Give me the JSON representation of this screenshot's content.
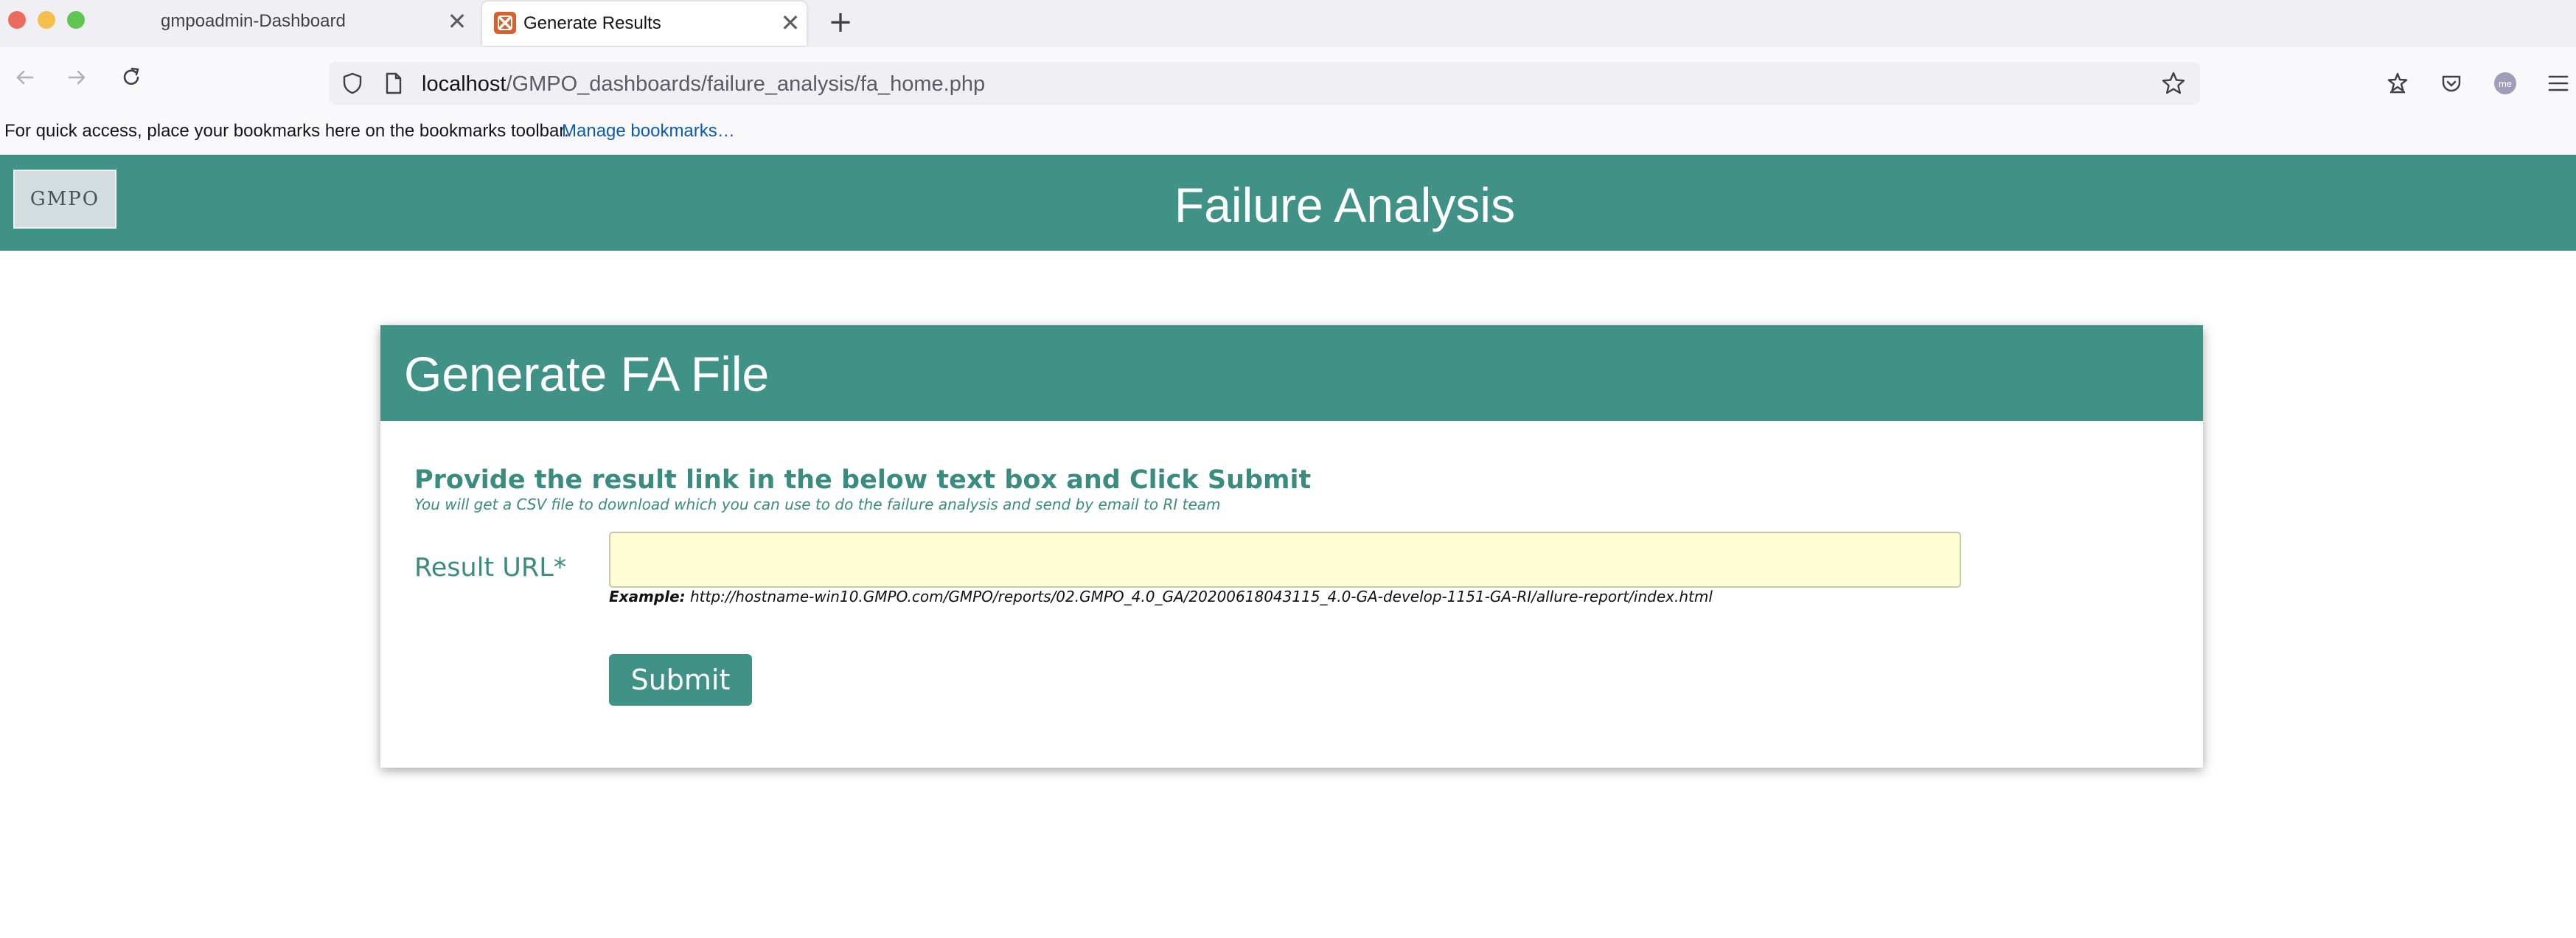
{
  "browser": {
    "tabs": [
      {
        "title": "gmpoadmin-Dashboard",
        "active": false
      },
      {
        "title": "Generate Results",
        "active": true
      }
    ],
    "close_glyph": "✕",
    "new_tab_glyph": "+",
    "url": {
      "host": "localhost",
      "path": "/GMPO_dashboards/failure_analysis/fa_home.php"
    },
    "avatar_initials": "me",
    "bookmarks_bar": {
      "text": "For quick access, place your bookmarks here on the bookmarks toolbar.",
      "link": "Manage bookmarks…"
    }
  },
  "header": {
    "logo_text": "GMPO",
    "title": "Failure Analysis"
  },
  "card": {
    "title": "Generate FA File",
    "instruction_title": "Provide the result link in the below text box and Click Submit",
    "instruction_subtitle": "You will get a CSV file to download which you can use to do the failure analysis and send by email to RI team",
    "field_label": "Result URL*",
    "input_value": "",
    "example_label": "Example:",
    "example_text": " http://hostname-win10.GMPO.com/GMPO/reports/02.GMPO_4.0_GA/20200618043115_4.0-GA-develop-1151-GA-RI/allure-report/index.html",
    "submit_label": "Submit"
  },
  "colors": {
    "primary": "#409287",
    "accent_text": "#3a8c81",
    "input_bg": "#fffdd6"
  }
}
